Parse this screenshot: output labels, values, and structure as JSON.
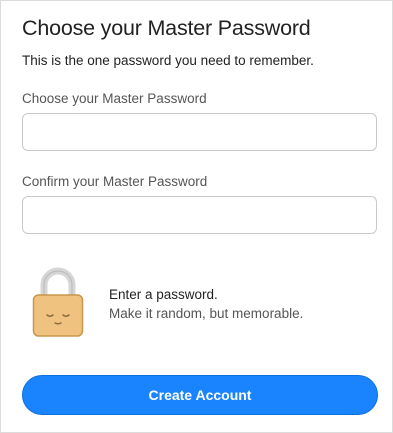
{
  "header": {
    "title": "Choose your Master Password",
    "subtitle": "This is the one password you need to remember."
  },
  "form": {
    "master_password": {
      "label": "Choose your Master Password",
      "value": "",
      "placeholder": ""
    },
    "confirm_password": {
      "label": "Confirm your Master Password",
      "value": "",
      "placeholder": ""
    }
  },
  "strength_hint": {
    "icon": "lock-icon",
    "title": "Enter a password.",
    "body": "Make it random, but memorable."
  },
  "actions": {
    "create_account_label": "Create Account"
  },
  "colors": {
    "accent": "#1a84ff",
    "lock_body": "#efc27f",
    "lock_shackle": "#d4d4d4"
  }
}
